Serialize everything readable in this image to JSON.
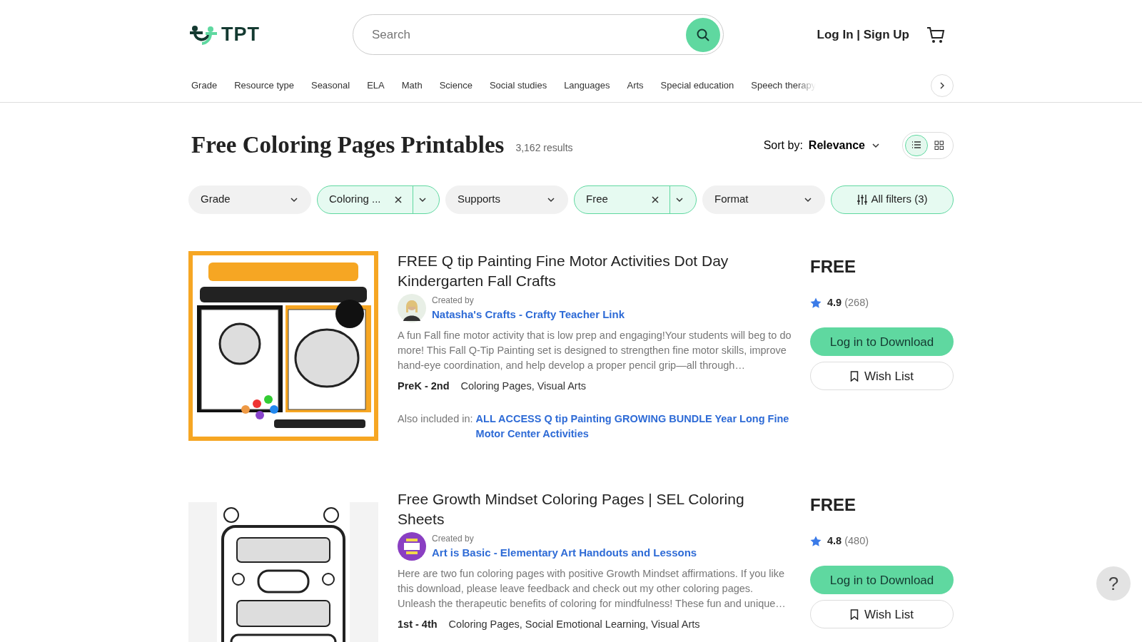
{
  "header": {
    "logo": "TPT",
    "search": {
      "placeholder": "Search"
    },
    "account_link": "Log In | Sign Up"
  },
  "categories": [
    "Grade",
    "Resource type",
    "Seasonal",
    "ELA",
    "Math",
    "Science",
    "Social studies",
    "Languages",
    "Arts",
    "Special education",
    "Speech therapy"
  ],
  "page": {
    "title": "Free Coloring Pages Printables",
    "results": "3,162 results",
    "sort_label": "Sort by:",
    "sort_value": "Relevance",
    "views": [
      {
        "kind": "list",
        "selected": true
      },
      {
        "kind": "grid",
        "selected": false
      }
    ]
  },
  "filters": [
    {
      "kind": "dropdown",
      "label": "Grade",
      "selected": false
    },
    {
      "kind": "dropdown",
      "label": "Coloring ...",
      "selected": true
    },
    {
      "kind": "dropdown",
      "label": "Supports",
      "selected": false
    },
    {
      "kind": "dropdown",
      "label": "Free",
      "selected": true
    },
    {
      "kind": "dropdown",
      "label": "Format",
      "selected": false
    },
    {
      "kind": "all",
      "label": "All filters (3)",
      "selected": true
    }
  ],
  "products": [
    {
      "title": "FREE Q tip Painting Fine Motor Activities Dot Day Kindergarten Fall Crafts",
      "created_by": "Created by",
      "author": "Natasha's Crafts - Crafty Teacher Link",
      "description": "A fun Fall fine motor activity that is low prep and engaging!Your students will beg to do more! This Fall Q-Tip Painting set is designed to strengthen fine motor skills, improve hand-eye coordination, and help develop a proper pencil grip—all through…",
      "grades": "PreK - 2nd",
      "subjects": "Coloring Pages, Visual Arts",
      "also_label": "Also included in:",
      "also_link": "ALL ACCESS Q tip Painting GROWING BUNDLE Year Long Fine Motor Center Activities",
      "price": "FREE",
      "rating": "4.9",
      "reviews": "(268)",
      "download": "Log in to Download",
      "wishlist": "Wish List"
    },
    {
      "title": "Free Growth Mindset Coloring Pages | SEL Coloring Sheets",
      "created_by": "Created by",
      "author": "Art is Basic - Elementary Art Handouts and Lessons",
      "description": "Here are two fun coloring pages with positive Growth Mindset affirmations. If you like this download, please leave feedback and check out my other coloring pages. Unleash the therapeutic benefits of coloring for mindfulness! These fun and unique…",
      "grades": "1st - 4th",
      "subjects": "Coloring Pages, Social Emotional Learning, Visual Arts",
      "price": "FREE",
      "rating": "4.8",
      "reviews": "(480)",
      "download": "Log in to Download",
      "wishlist": "Wish List"
    }
  ],
  "help_button": "?"
}
